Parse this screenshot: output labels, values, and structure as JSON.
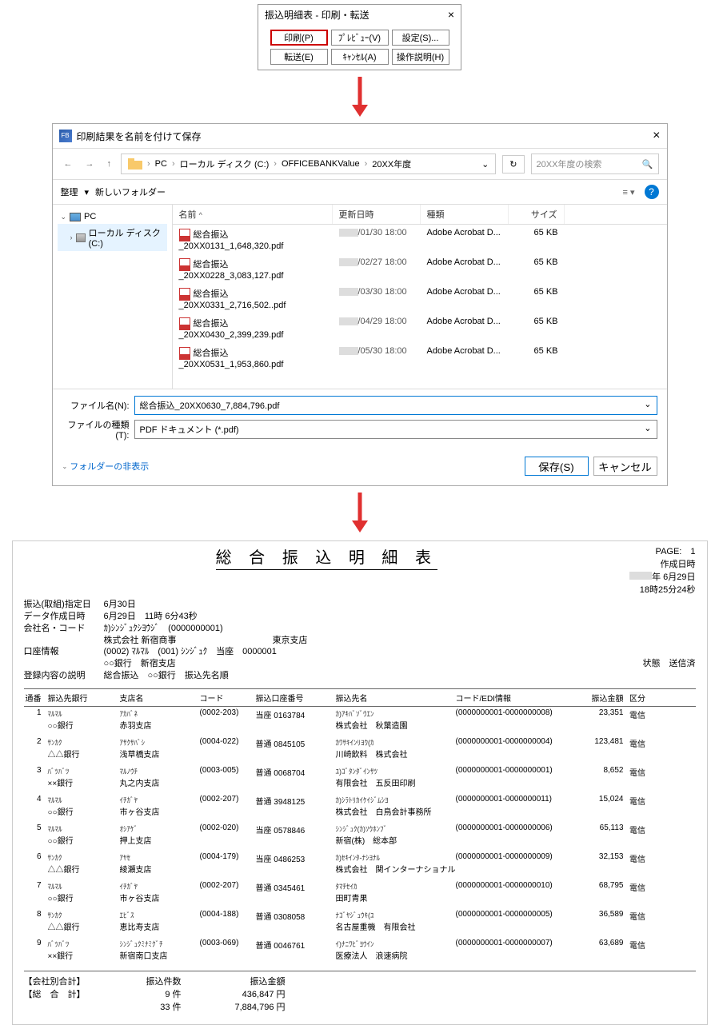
{
  "dialog1": {
    "title": "振込明細表 - 印刷・転送",
    "btn_print": "印刷(P)",
    "btn_preview": "ﾌﾟﾚﾋﾞｭｰ(V)",
    "btn_settings": "設定(S)...",
    "btn_forward": "転送(E)",
    "btn_cancel": "ｷｬﾝｾﾙ(A)",
    "btn_help": "操作説明(H)"
  },
  "saveDialog": {
    "title": "印刷結果を名前を付けて保存",
    "breadcrumb": [
      "PC",
      "ローカル ディスク (C:)",
      "OFFICEBANKValue",
      "20XX年度"
    ],
    "search_placeholder": "20XX年度の検索",
    "toolbar_organize": "整理",
    "toolbar_newfolder": "新しいフォルダー",
    "tree": {
      "pc": "PC",
      "drive": "ローカル ディスク (C:)"
    },
    "columns": {
      "name": "名前",
      "date": "更新日時",
      "type": "種類",
      "size": "サイズ"
    },
    "files": [
      {
        "name": "総合振込_20XX0131_1,648,320.pdf",
        "date": "/01/30 18:00",
        "type": "Adobe Acrobat D...",
        "size": "65 KB"
      },
      {
        "name": "総合振込_20XX0228_3,083,127.pdf",
        "date": "/02/27 18:00",
        "type": "Adobe Acrobat D...",
        "size": "65 KB"
      },
      {
        "name": "総合振込_20XX0331_2,716,502..pdf",
        "date": "/03/30 18:00",
        "type": "Adobe Acrobat D...",
        "size": "65 KB"
      },
      {
        "name": "総合振込_20XX0430_2,399,239.pdf",
        "date": "/04/29 18:00",
        "type": "Adobe Acrobat D...",
        "size": "65 KB"
      },
      {
        "name": "総合振込_20XX0531_1,953,860.pdf",
        "date": "/05/30 18:00",
        "type": "Adobe Acrobat D...",
        "size": "65 KB"
      }
    ],
    "filename_label": "ファイル名(N):",
    "filename_value": "総合振込_20XX0630_7,884,796.pdf",
    "filetype_label": "ファイルの種類(T):",
    "filetype_value": "PDF ドキュメント (*.pdf)",
    "hide_folders": "フォルダーの非表示",
    "btn_save": "保存(S)",
    "btn_cancel": "キャンセル"
  },
  "report": {
    "title": "総 合 振 込 明 細 表",
    "page_label": "PAGE:",
    "page_num": "1",
    "created_label": "作成日時",
    "created_date": "年  6月29日",
    "created_time": "18時25分24秒",
    "meta": {
      "date_lbl": "振込(取組)指定日",
      "date_val": "6月30日",
      "data_lbl": "データ作成日時",
      "data_val": "6月29日　11時  6分43秒",
      "comp_lbl": "会社名・コード",
      "comp_val1": "ｶ)ｼﾝｼﾞｭｸｼﾖｳｼﾞ　(0000000001)",
      "comp_val2": "株式会社 新宿商事",
      "acct_lbl": "口座情報",
      "acct_val1": "(0002) ﾏﾙﾏﾙ　(001) ｼﾝｼﾞｭｸ　当座　0000001",
      "acct_val2": "○○銀行　新宿支店",
      "acct_branch": "東京支店",
      "desc_lbl": "登録内容の説明",
      "desc_val": "総合振込　○○銀行　振込先名順"
    },
    "status_lbl": "状態",
    "status_val": "送信済",
    "cols": {
      "no": "通番",
      "bank": "振込先銀行",
      "branch": "支店名",
      "code": "コード",
      "acct": "振込口座番号",
      "payee": "振込先名",
      "edi": "コード/EDI情報",
      "amt": "振込金額",
      "type": "区分"
    },
    "rows": [
      {
        "no": "1",
        "bank1": "ﾏﾙﾏﾙ",
        "bank2": "○○銀行",
        "branch1": "ｱｶﾊﾞﾈ",
        "branch2": "赤羽支店",
        "code": "(0002-203)",
        "acct": "当座 0163784",
        "payee1": "ｶ)ｱｷﾊﾞｿﾞｳｴﾝ",
        "payee2": "株式会社　秋葉造園",
        "edi": "(0000000001-0000000008)",
        "amt": "23,351",
        "type": "電信"
      },
      {
        "no": "2",
        "bank1": "ｻﾝｶｸ",
        "bank2": "△△銀行",
        "branch1": "ｱｻｸｻﾊﾞｼ",
        "branch2": "浅草橋支店",
        "code": "(0004-022)",
        "acct": "普通 0845105",
        "payee1": "ｶﾜｻｷｲﾝﾘﾖｳ(ｶ",
        "payee2": "川崎飲料　株式会社",
        "edi": "(0000000001-0000000004)",
        "amt": "123,481",
        "type": "電信"
      },
      {
        "no": "3",
        "bank1": "ﾊﾞﾂﾊﾞﾂ",
        "bank2": "××銀行",
        "branch1": "ﾏﾙﾉｳﾁ",
        "branch2": "丸之内支店",
        "code": "(0003-005)",
        "acct": "普通 0068704",
        "payee1": "ﾕ)ｺﾞﾀﾝﾀﾞｲﾝｻﾂ",
        "payee2": "有限会社　五反田印刷",
        "edi": "(0000000001-0000000001)",
        "amt": "8,652",
        "type": "電信"
      },
      {
        "no": "4",
        "bank1": "ﾏﾙﾏﾙ",
        "bank2": "○○銀行",
        "branch1": "ｲﾁｶﾞﾔ",
        "branch2": "市ヶ谷支店",
        "code": "(0002-207)",
        "acct": "普通 3948125",
        "payee1": "ｶ)ｼﾗﾄﾘｶｲｹｲｼﾞﾑｼﾖ",
        "payee2": "株式会社　白鳥会計事務所",
        "edi": "(0000000001-0000000011)",
        "amt": "15,024",
        "type": "電信"
      },
      {
        "no": "5",
        "bank1": "ﾏﾙﾏﾙ",
        "bank2": "○○銀行",
        "branch1": "ｵｼｱｹﾞ",
        "branch2": "押上支店",
        "code": "(0002-020)",
        "acct": "当座 0578846",
        "payee1": "ｼﾝｼﾞｭｸ(ｶ)ｿｳﾎﾝﾌﾞ",
        "payee2": "新宿(株)　総本部",
        "edi": "(0000000001-0000000006)",
        "amt": "65,113",
        "type": "電信"
      },
      {
        "no": "6",
        "bank1": "ｻﾝｶｸ",
        "bank2": "△△銀行",
        "branch1": "ｱﾔｾ",
        "branch2": "綾瀬支店",
        "code": "(0004-179)",
        "acct": "当座 0486253",
        "payee1": "ｶ)ｾｷｲﾝﾀ-ﾅｼﾖﾅﾙ",
        "payee2": "株式会社　関インターナショナル",
        "edi": "(0000000001-0000000009)",
        "amt": "32,153",
        "type": "電信"
      },
      {
        "no": "7",
        "bank1": "ﾏﾙﾏﾙ",
        "bank2": "○○銀行",
        "branch1": "ｲﾁｶﾞﾔ",
        "branch2": "市ヶ谷支店",
        "code": "(0002-207)",
        "acct": "普通 0345461",
        "payee1": "ﾀﾏﾁｾｲｶ",
        "payee2": "田町青果",
        "edi": "(0000000001-0000000010)",
        "amt": "68,795",
        "type": "電信"
      },
      {
        "no": "8",
        "bank1": "ｻﾝｶｸ",
        "bank2": "△△銀行",
        "branch1": "ｴﾋﾞｽ",
        "branch2": "恵比寿支店",
        "code": "(0004-188)",
        "acct": "普通 0308058",
        "payee1": "ﾅｺﾞﾔｼﾞｭｳｷ(ﾕ",
        "payee2": "名古屋重機　有限会社",
        "edi": "(0000000001-0000000005)",
        "amt": "36,589",
        "type": "電信"
      },
      {
        "no": "9",
        "bank1": "ﾊﾞﾂﾊﾞﾂ",
        "bank2": "××銀行",
        "branch1": "ｼﾝｼﾞｭｸﾐﾅﾐｸﾞﾁ",
        "branch2": "新宿南口支店",
        "code": "(0003-069)",
        "acct": "普通 0046761",
        "payee1": "ｲ)ﾅﾆﾜﾋﾞﾖｳｲﾝ",
        "payee2": "医療法人　浪速病院",
        "edi": "(0000000001-0000000007)",
        "amt": "63,689",
        "type": "電信"
      }
    ],
    "footer": {
      "lbl1": "【会社別合計】",
      "lbl2": "【総　合　計】",
      "col1_lbl": "振込件数",
      "col2_lbl": "振込金額",
      "v1a": "9 件",
      "v1b": "436,847  円",
      "v2a": "33 件",
      "v2b": "7,884,796  円"
    }
  },
  "chart_data": {
    "type": "table",
    "title": "総合振込明細表",
    "columns": [
      "通番",
      "振込先銀行",
      "支店名",
      "コード",
      "振込口座番号",
      "振込先名",
      "コード/EDI情報",
      "振込金額",
      "区分"
    ],
    "rows": [
      [
        1,
        "○○銀行",
        "赤羽支店",
        "0002-203",
        "当座 0163784",
        "株式会社 秋葉造園",
        "0000000001-0000000008",
        23351,
        "電信"
      ],
      [
        2,
        "△△銀行",
        "浅草橋支店",
        "0004-022",
        "普通 0845105",
        "川崎飲料 株式会社",
        "0000000001-0000000004",
        123481,
        "電信"
      ],
      [
        3,
        "××銀行",
        "丸之内支店",
        "0003-005",
        "普通 0068704",
        "有限会社 五反田印刷",
        "0000000001-0000000001",
        8652,
        "電信"
      ],
      [
        4,
        "○○銀行",
        "市ヶ谷支店",
        "0002-207",
        "普通 3948125",
        "株式会社 白鳥会計事務所",
        "0000000001-0000000011",
        15024,
        "電信"
      ],
      [
        5,
        "○○銀行",
        "押上支店",
        "0002-020",
        "当座 0578846",
        "新宿(株) 総本部",
        "0000000001-0000000006",
        65113,
        "電信"
      ],
      [
        6,
        "△△銀行",
        "綾瀬支店",
        "0004-179",
        "当座 0486253",
        "株式会社 関インターナショナル",
        "0000000001-0000000009",
        32153,
        "電信"
      ],
      [
        7,
        "○○銀行",
        "市ヶ谷支店",
        "0002-207",
        "普通 0345461",
        "田町青果",
        "0000000001-0000000010",
        68795,
        "電信"
      ],
      [
        8,
        "△△銀行",
        "恵比寿支店",
        "0004-188",
        "普通 0308058",
        "名古屋重機 有限会社",
        "0000000001-0000000005",
        36589,
        "電信"
      ],
      [
        9,
        "××銀行",
        "新宿南口支店",
        "0003-069",
        "普通 0046761",
        "医療法人 浪速病院",
        "0000000001-0000000007",
        63689,
        "電信"
      ]
    ],
    "totals": {
      "company_count": 9,
      "company_amount": 436847,
      "grand_count": 33,
      "grand_amount": 7884796
    }
  }
}
